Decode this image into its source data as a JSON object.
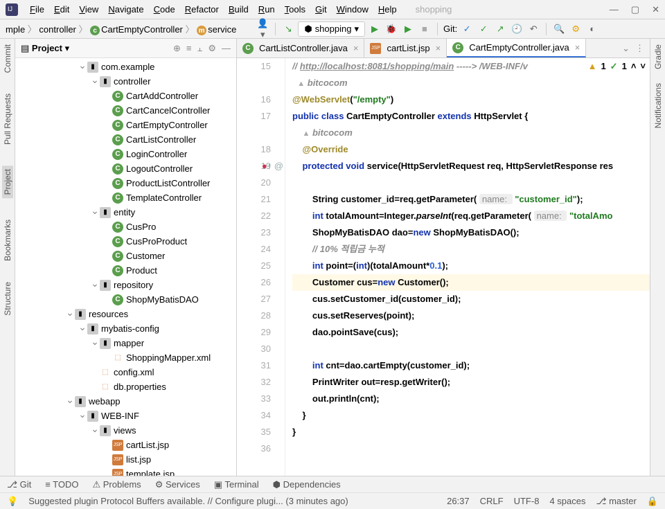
{
  "menus": [
    "File",
    "Edit",
    "View",
    "Navigate",
    "Code",
    "Refactor",
    "Build",
    "Run",
    "Tools",
    "Git",
    "Window",
    "Help"
  ],
  "title_dim": "shopping",
  "breadcrumbs": [
    {
      "text": "mple",
      "badge": ""
    },
    {
      "text": "controller",
      "badge": ""
    },
    {
      "text": "CartEmptyController",
      "badge": "c"
    },
    {
      "text": "service",
      "badge": "m"
    }
  ],
  "run_config": "shopping",
  "git_label": "Git:",
  "proj_label": "Project",
  "rails_left": [
    "Commit",
    "Pull Requests",
    "Project",
    "Bookmarks",
    "Structure"
  ],
  "rails_right": [
    "Gradle",
    "Notifications"
  ],
  "tree": [
    {
      "d": 5,
      "a": "down",
      "ic": "fold",
      "t": "com.example"
    },
    {
      "d": 6,
      "a": "down",
      "ic": "fold",
      "t": "controller"
    },
    {
      "d": 7,
      "a": "",
      "ic": "class",
      "t": "CartAddController"
    },
    {
      "d": 7,
      "a": "",
      "ic": "class",
      "t": "CartCancelController"
    },
    {
      "d": 7,
      "a": "",
      "ic": "class",
      "t": "CartEmptyController"
    },
    {
      "d": 7,
      "a": "",
      "ic": "class",
      "t": "CartListController"
    },
    {
      "d": 7,
      "a": "",
      "ic": "class",
      "t": "LoginController"
    },
    {
      "d": 7,
      "a": "",
      "ic": "class",
      "t": "LogoutController"
    },
    {
      "d": 7,
      "a": "",
      "ic": "class",
      "t": "ProductListController"
    },
    {
      "d": 7,
      "a": "",
      "ic": "class",
      "t": "TemplateController"
    },
    {
      "d": 6,
      "a": "down",
      "ic": "fold",
      "t": "entity"
    },
    {
      "d": 7,
      "a": "",
      "ic": "class",
      "t": "CusPro"
    },
    {
      "d": 7,
      "a": "",
      "ic": "class",
      "t": "CusProProduct"
    },
    {
      "d": 7,
      "a": "",
      "ic": "class",
      "t": "Customer"
    },
    {
      "d": 7,
      "a": "",
      "ic": "class",
      "t": "Product"
    },
    {
      "d": 6,
      "a": "down",
      "ic": "fold",
      "t": "repository"
    },
    {
      "d": 7,
      "a": "",
      "ic": "class",
      "t": "ShopMyBatisDAO"
    },
    {
      "d": 4,
      "a": "down",
      "ic": "fold",
      "t": "resources"
    },
    {
      "d": 5,
      "a": "down",
      "ic": "fold",
      "t": "mybatis-config"
    },
    {
      "d": 6,
      "a": "down",
      "ic": "fold",
      "t": "mapper"
    },
    {
      "d": 7,
      "a": "",
      "ic": "xml",
      "t": "ShoppingMapper.xml"
    },
    {
      "d": 6,
      "a": "",
      "ic": "xml",
      "t": "config.xml"
    },
    {
      "d": 6,
      "a": "",
      "ic": "xml",
      "t": "db.properties"
    },
    {
      "d": 4,
      "a": "down",
      "ic": "fold",
      "t": "webapp"
    },
    {
      "d": 5,
      "a": "down",
      "ic": "fold",
      "t": "WEB-INF"
    },
    {
      "d": 6,
      "a": "down",
      "ic": "fold",
      "t": "views"
    },
    {
      "d": 7,
      "a": "",
      "ic": "jsp",
      "t": "cartList.jsp"
    },
    {
      "d": 7,
      "a": "",
      "ic": "jsp",
      "t": "list.jsp"
    },
    {
      "d": 7,
      "a": "",
      "ic": "jsp",
      "t": "template.jsp"
    }
  ],
  "tabs": [
    {
      "label": "CartListController.java",
      "active": false,
      "ic": "class"
    },
    {
      "label": "cartList.jsp",
      "active": false,
      "ic": "jsp"
    },
    {
      "label": "CartEmptyController.java",
      "active": true,
      "ic": "class"
    }
  ],
  "line_start": 15,
  "ind_warn": "1",
  "ind_typo": "1",
  "code": {
    "l15_url": "http://localhost:8081/shopping/main",
    "l15_tail": " -----> /WEB-INF/v",
    "author": "bitcocom",
    "ws": "@WebServlet",
    "ws_arg": "\"/empty\"",
    "pub": "public class ",
    "cname": "CartEmptyController ",
    "ext": "extends ",
    "sup": "HttpServlet {",
    "ov": "@Override",
    "prot": "protected void ",
    "svc": "service",
    "sig": "(HttpServletRequest req, HttpServletResponse res",
    "s1a": "String customer_id=req.getParameter( ",
    "h1": "name: ",
    "s1b": "\"customer_id\"",
    "s1c": ");",
    "s2a": "int",
    "s2b": " totalAmount=Integer.",
    "s2c": "parseInt",
    "s2d": "(req.getParameter( ",
    "h2": "name: ",
    "s2e": "\"totalAmo",
    "s3a": "ShopMyBatisDAO dao=",
    "s3b": "new ",
    "s3c": "ShopMyBatisDAO();",
    "cmt": "// 10% 적립금 누적",
    "s4a": "int",
    "s4b": " point=(",
    "s4c": "int",
    "s4d": ")(totalAmount*",
    "s4e": "0.1",
    "s4f": ");",
    "s5a": "Customer cus=",
    "s5b": "new ",
    "s5c": "Customer();",
    "s6": "cus.setCustomer_id(customer_id);",
    "s7": "cus.setReserves(point);",
    "s8": "dao.pointSave(cus);",
    "s9a": "int",
    "s9b": " cnt=dao.cartEmpty(customer_id);",
    "s10": "PrintWriter out=resp.getWriter();",
    "s11": "out.println(cnt);",
    "cb1": "}",
    "cb2": "}"
  },
  "bottom_tools": [
    "Git",
    "TODO",
    "Problems",
    "Services",
    "Terminal",
    "Dependencies"
  ],
  "status_msg": "Suggested plugin Protocol Buffers available. // Configure plugi... (3 minutes ago)",
  "status_right": [
    "26:37",
    "CRLF",
    "UTF-8",
    "4 spaces",
    "master"
  ]
}
